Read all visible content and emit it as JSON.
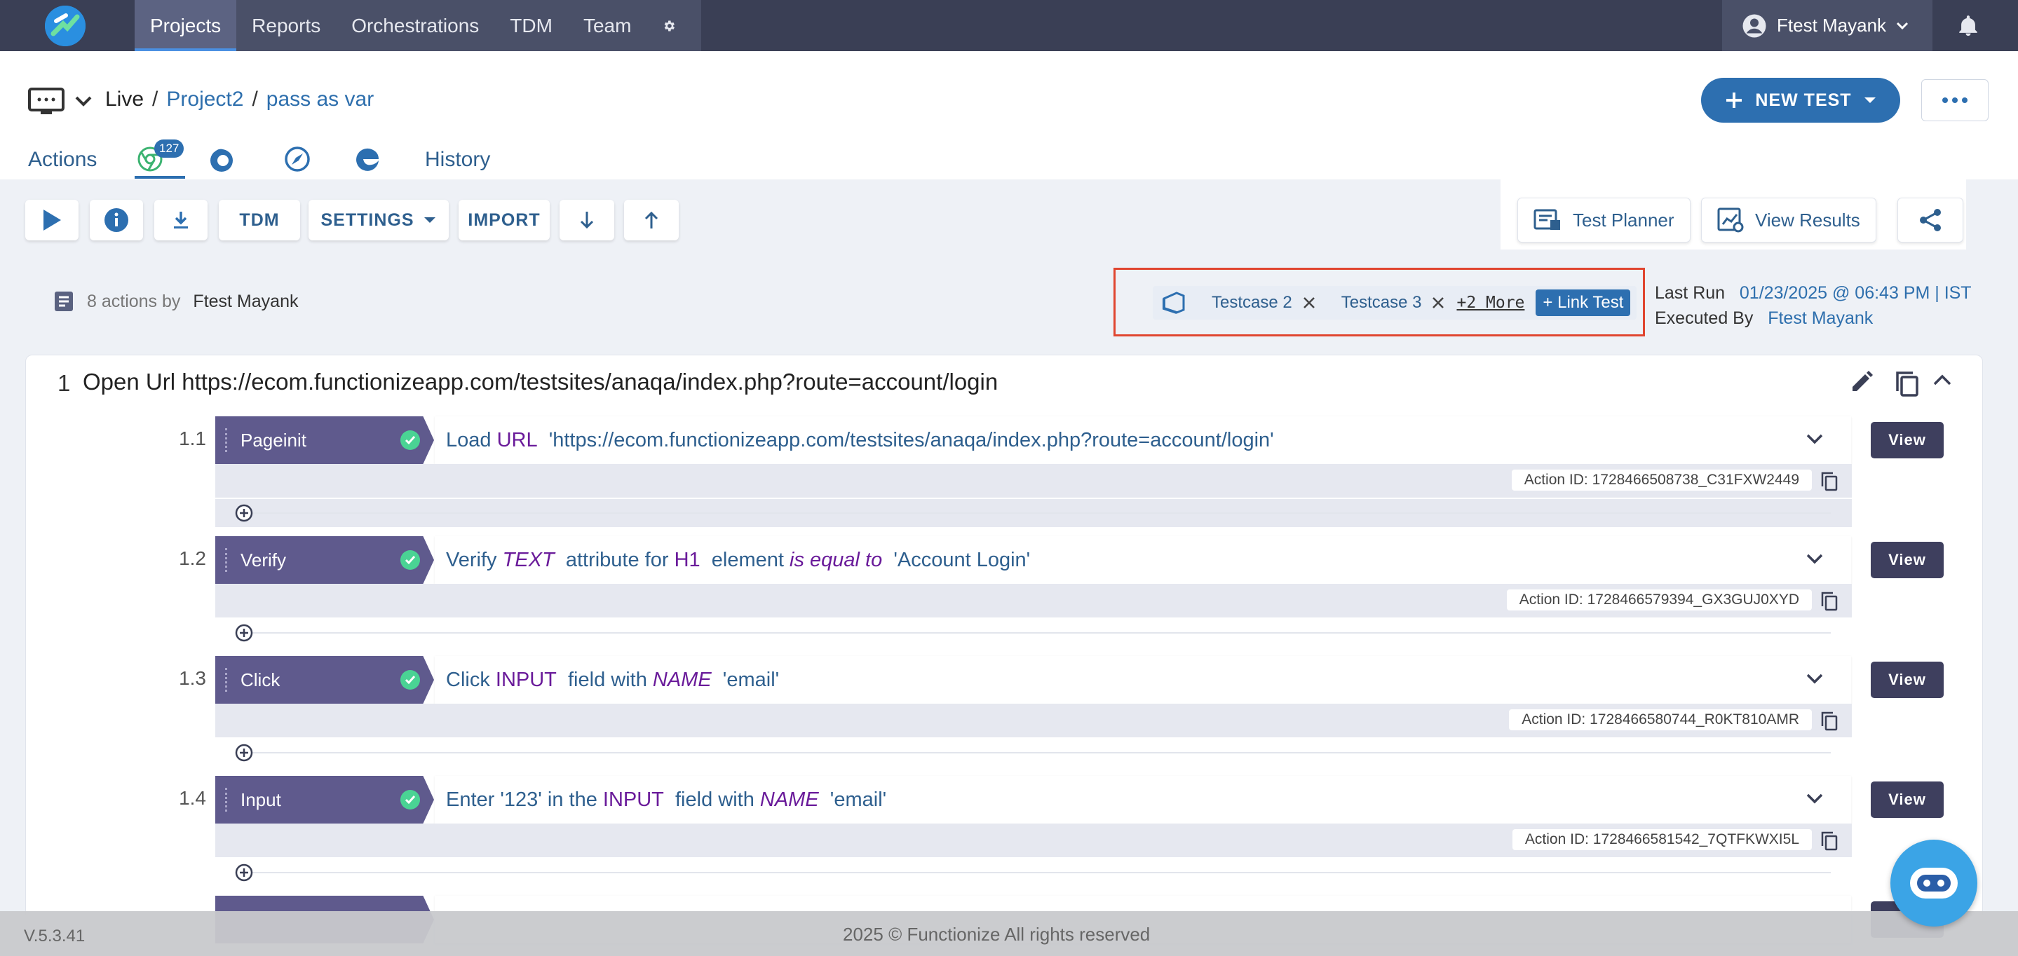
{
  "nav": {
    "items": [
      {
        "label": "Projects",
        "active": true
      },
      {
        "label": "Reports"
      },
      {
        "label": "Orchestrations"
      },
      {
        "label": "TDM"
      },
      {
        "label": "Team"
      }
    ],
    "gear_icon": "gear-icon",
    "user_name": "Ftest Mayank",
    "bell_icon": "bell-icon"
  },
  "header": {
    "mode": "Live",
    "breadcrumb": [
      "Project2",
      "pass as var"
    ],
    "new_test_label": "NEW TEST",
    "tabs": {
      "actions": "Actions",
      "chrome_badge": "127",
      "history": "History"
    }
  },
  "toolbar": {
    "tdm": "TDM",
    "settings": "SETTINGS",
    "import": "IMPORT",
    "test_planner": "Test Planner",
    "view_results": "View Results"
  },
  "info": {
    "actions_count": "8 actions by",
    "author": "Ftest Mayank",
    "linked_tests": [
      "Testcase 2",
      "Testcase 3"
    ],
    "more": "+2 More",
    "link_test": "+ Link Test",
    "last_run_label": "Last Run",
    "last_run_value": "01/23/2025 @ 06:43 PM | IST",
    "executed_by_label": "Executed By",
    "executed_by_value": "Ftest Mayank"
  },
  "step": {
    "number": "1",
    "title": "Open Url https://ecom.functionizeapp.com/testsites/anaqa/index.php?route=account/login",
    "actions": [
      {
        "num": "1.1",
        "type": "Pageinit",
        "desc": [
          [
            "t",
            "Load "
          ],
          [
            "kw",
            "URL"
          ],
          [
            "t",
            "  'https://ecom.functionizeapp.com/testsites/anaqa/index.php?route=account/login'"
          ]
        ],
        "action_id": "Action ID: 1728466508738_C31FXW2449"
      },
      {
        "num": "1.2",
        "type": "Verify",
        "desc": [
          [
            "t",
            "Verify "
          ],
          [
            "it",
            "TEXT"
          ],
          [
            "t",
            "  attribute for "
          ],
          [
            "kw",
            "H1"
          ],
          [
            "t",
            "  element "
          ],
          [
            "it",
            "is equal to"
          ],
          [
            "t",
            "  'Account Login'"
          ]
        ],
        "action_id": "Action ID: 1728466579394_GX3GUJ0XYD"
      },
      {
        "num": "1.3",
        "type": "Click",
        "desc": [
          [
            "t",
            "Click "
          ],
          [
            "kw",
            "INPUT"
          ],
          [
            "t",
            "  field with "
          ],
          [
            "it",
            "NAME"
          ],
          [
            "t",
            "  'email'"
          ]
        ],
        "action_id": "Action ID: 1728466580744_R0KT810AMR"
      },
      {
        "num": "1.4",
        "type": "Input",
        "desc": [
          [
            "t",
            "Enter '123' in the "
          ],
          [
            "kw",
            "INPUT"
          ],
          [
            "t",
            "  field with "
          ],
          [
            "it",
            "NAME"
          ],
          [
            "t",
            "  'email'"
          ]
        ],
        "action_id": "Action ID: 1728466581542_7QTFKWXI5L"
      }
    ],
    "view_label": "View"
  },
  "footer": {
    "version": "V.5.3.41",
    "copyright": "2025 © Functionize All rights reserved"
  },
  "colors": {
    "nav_bg": "#3a3f55",
    "accent": "#2d6fb0",
    "action_tag": "#5f5a8d",
    "check": "#4ad394",
    "highlight_border": "#e0452f"
  }
}
